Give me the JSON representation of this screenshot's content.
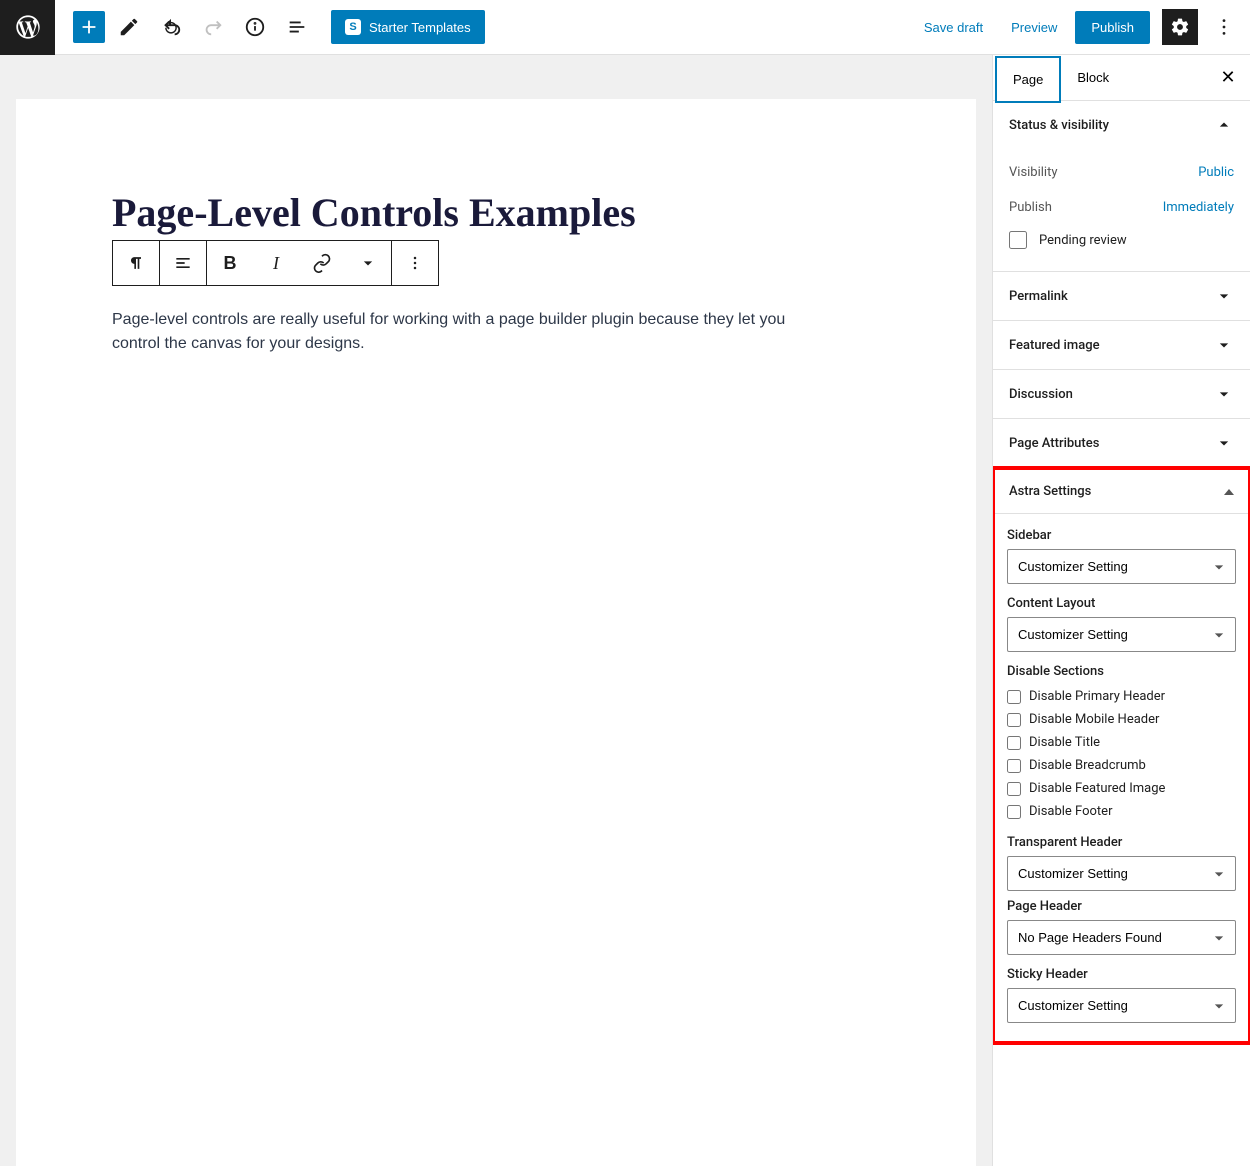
{
  "toolbar": {
    "starter_label": "Starter Templates",
    "save_draft": "Save draft",
    "preview": "Preview",
    "publish": "Publish"
  },
  "tabs": {
    "page": "Page",
    "block": "Block"
  },
  "editor": {
    "title": "Page-Level Controls Examples",
    "paragraph": "Page-level controls are really useful for working with a page builder plugin because they let you control the canvas for your designs."
  },
  "panels": {
    "status": {
      "title": "Status & visibility",
      "visibility_label": "Visibility",
      "visibility_value": "Public",
      "publish_label": "Publish",
      "publish_value": "Immediately",
      "pending_review": "Pending review"
    },
    "permalink": "Permalink",
    "featured_image": "Featured image",
    "discussion": "Discussion",
    "page_attributes": "Page Attributes"
  },
  "astra": {
    "title": "Astra Settings",
    "sidebar_label": "Sidebar",
    "sidebar_value": "Customizer Setting",
    "content_layout_label": "Content Layout",
    "content_layout_value": "Customizer Setting",
    "disable_sections_label": "Disable Sections",
    "disable_items": [
      "Disable Primary Header",
      "Disable Mobile Header",
      "Disable Title",
      "Disable Breadcrumb",
      "Disable Featured Image",
      "Disable Footer"
    ],
    "transparent_header_label": "Transparent Header",
    "transparent_header_value": "Customizer Setting",
    "page_header_label": "Page Header",
    "page_header_value": "No Page Headers Found",
    "sticky_header_label": "Sticky Header",
    "sticky_header_value": "Customizer Setting"
  }
}
